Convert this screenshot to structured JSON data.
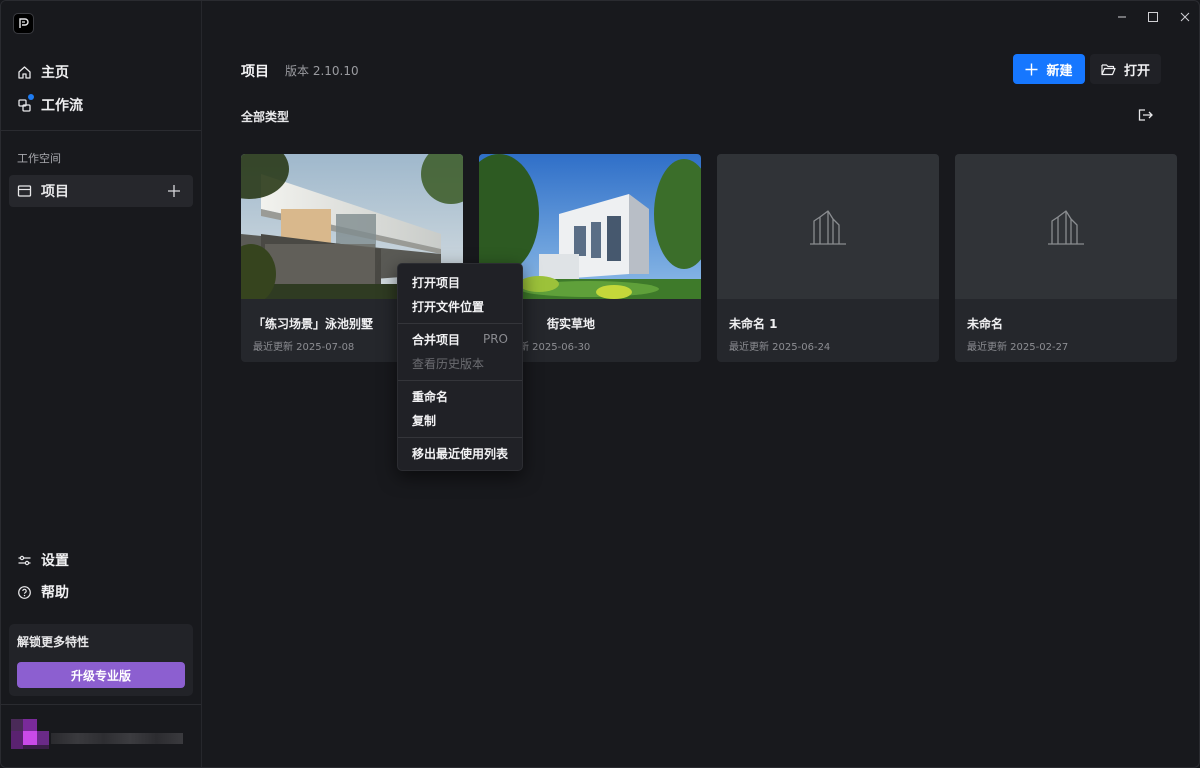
{
  "sidebar": {
    "nav": [
      {
        "label": "主页",
        "icon": "home-icon"
      },
      {
        "label": "工作流",
        "icon": "workflow-icon"
      }
    ],
    "workspace_label": "工作空间",
    "workspace_item": "项目",
    "settings": "设置",
    "help": "帮助",
    "upgrade_title": "解锁更多特性",
    "upgrade_button": "升级专业版"
  },
  "header": {
    "title": "项目",
    "version": "版本 2.10.10",
    "new_button": "新建",
    "open_button": "打开"
  },
  "filter_label": "全部类型",
  "projects": [
    {
      "title": "「练习场景」泳池别墅",
      "date": "最近更新 2025-07-08",
      "has_thumbnail": true
    },
    {
      "title": "街实草地",
      "date": "新 2025-06-30",
      "has_thumbnail": true
    },
    {
      "title": "未命名 1",
      "date": "最近更新 2025-06-24",
      "has_thumbnail": false
    },
    {
      "title": "未命名",
      "date": "最近更新 2025-02-27",
      "has_thumbnail": false
    }
  ],
  "context_menu": {
    "open_project": "打开项目",
    "open_location": "打开文件位置",
    "merge_project": "合并项目",
    "pro_badge": "PRO",
    "view_history": "查看历史版本",
    "rename": "重命名",
    "duplicate": "复制",
    "remove_recent": "移出最近使用列表"
  },
  "colors": {
    "accent": "#1677ff",
    "upgrade": "#8c5fd0",
    "background": "#18191d",
    "card": "#25272c"
  }
}
